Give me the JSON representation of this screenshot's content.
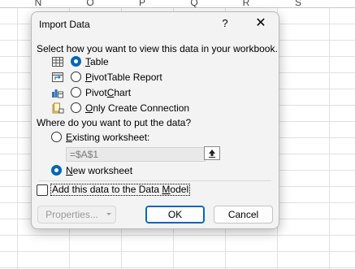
{
  "spreadsheet": {
    "columns": [
      "N",
      "O",
      "P",
      "Q",
      "R",
      "S"
    ]
  },
  "dialog": {
    "title": "Import Data",
    "help_label": "?",
    "close_label": "✕",
    "view_prompt": "Select how you want to view this data in your workbook.",
    "view_options": [
      {
        "pre": "",
        "mn": "T",
        "post": "able",
        "icon": "table-icon",
        "checked": true
      },
      {
        "pre": "",
        "mn": "P",
        "post": "ivotTable Report",
        "icon": "pivottable-icon",
        "checked": false
      },
      {
        "pre": "Pivot",
        "mn": "C",
        "post": "hart",
        "icon": "pivotchart-icon",
        "checked": false
      },
      {
        "pre": "",
        "mn": "O",
        "post": "nly Create Connection",
        "icon": "connection-icon",
        "checked": false
      }
    ],
    "location_prompt": "Where do you want to put the data?",
    "existing_worksheet": {
      "pre": "",
      "mn": "E",
      "post": "xisting worksheet:",
      "checked": false
    },
    "reference_value": "=$A$1",
    "new_worksheet": {
      "pre": "",
      "mn": "N",
      "post": "ew worksheet",
      "checked": true
    },
    "data_model": {
      "pre": "Add this data to the Data ",
      "mn": "M",
      "post": "odel",
      "checked": false
    },
    "buttons": {
      "properties": "Properties...",
      "ok": "OK",
      "cancel": "Cancel"
    }
  }
}
